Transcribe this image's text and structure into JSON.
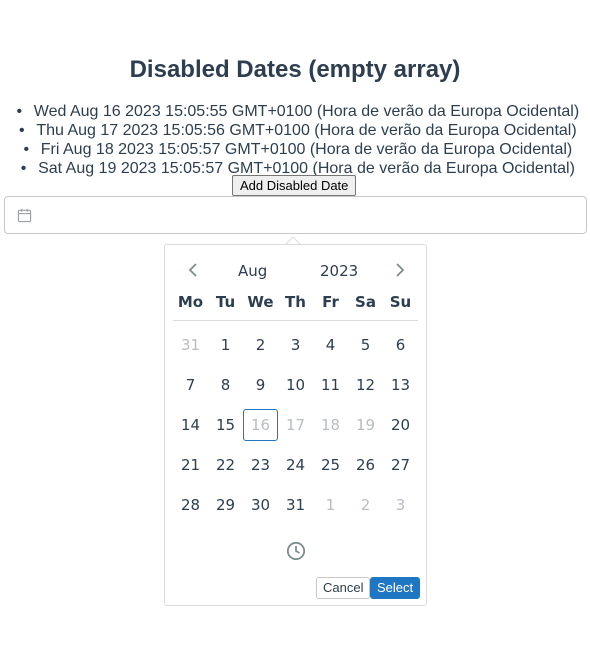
{
  "page_title": "Disabled Dates (empty array)",
  "disabled_dates": [
    "Wed Aug 16 2023 15:05:55 GMT+0100 (Hora de verão da Europa Ocidental)",
    "Thu Aug 17 2023 15:05:56 GMT+0100 (Hora de verão da Europa Ocidental)",
    "Fri Aug 18 2023 15:05:57 GMT+0100 (Hora de verão da Europa Ocidental)",
    "Sat Aug 19 2023 15:05:57 GMT+0100 (Hora de verão da Europa Ocidental)"
  ],
  "add_button_label": "Add Disabled Date",
  "date_input": {
    "value": "",
    "icon": "calendar-icon"
  },
  "calendar": {
    "month": "Aug",
    "year": "2023",
    "weekdays": [
      "Mo",
      "Tu",
      "We",
      "Th",
      "Fr",
      "Sa",
      "Su"
    ],
    "weeks": [
      [
        {
          "d": "31",
          "muted": true
        },
        {
          "d": "1",
          "muted": false
        },
        {
          "d": "2",
          "muted": false
        },
        {
          "d": "3",
          "muted": false
        },
        {
          "d": "4",
          "muted": false
        },
        {
          "d": "5",
          "muted": false
        },
        {
          "d": "6",
          "muted": false
        }
      ],
      [
        {
          "d": "7",
          "muted": false
        },
        {
          "d": "8",
          "muted": false
        },
        {
          "d": "9",
          "muted": false
        },
        {
          "d": "10",
          "muted": false
        },
        {
          "d": "11",
          "muted": false
        },
        {
          "d": "12",
          "muted": false
        },
        {
          "d": "13",
          "muted": false
        }
      ],
      [
        {
          "d": "14",
          "muted": false
        },
        {
          "d": "15",
          "muted": false
        },
        {
          "d": "16",
          "muted": true,
          "today": true
        },
        {
          "d": "17",
          "muted": true
        },
        {
          "d": "18",
          "muted": true
        },
        {
          "d": "19",
          "muted": true
        },
        {
          "d": "20",
          "muted": false
        }
      ],
      [
        {
          "d": "21",
          "muted": false
        },
        {
          "d": "22",
          "muted": false
        },
        {
          "d": "23",
          "muted": false
        },
        {
          "d": "24",
          "muted": false
        },
        {
          "d": "25",
          "muted": false
        },
        {
          "d": "26",
          "muted": false
        },
        {
          "d": "27",
          "muted": false
        }
      ],
      [
        {
          "d": "28",
          "muted": false
        },
        {
          "d": "29",
          "muted": false
        },
        {
          "d": "30",
          "muted": false
        },
        {
          "d": "31",
          "muted": false
        },
        {
          "d": "1",
          "muted": true
        },
        {
          "d": "2",
          "muted": true
        },
        {
          "d": "3",
          "muted": true
        }
      ]
    ],
    "time_icon": "clock-icon",
    "cancel_label": "Cancel",
    "select_label": "Select"
  },
  "colors": {
    "accent": "#1f76c2",
    "text": "#2c3e50",
    "muted": "#b8bdc3"
  }
}
